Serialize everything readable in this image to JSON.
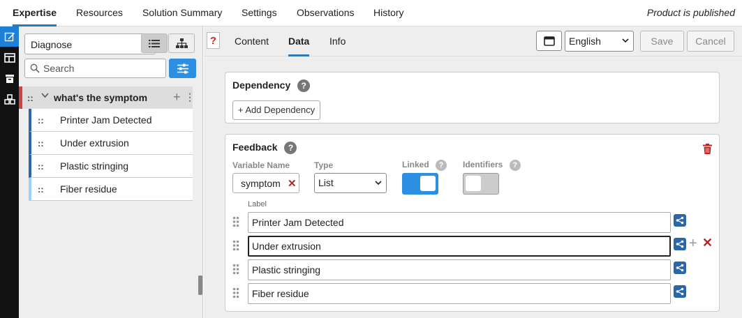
{
  "top_tabs": [
    {
      "label": "Expertise",
      "active": true
    },
    {
      "label": "Resources"
    },
    {
      "label": "Solution Summary"
    },
    {
      "label": "Settings"
    },
    {
      "label": "Observations"
    },
    {
      "label": "History"
    }
  ],
  "status": "Product is published",
  "sidebar": {
    "mode_select": "Diagnose",
    "search_placeholder": "Search",
    "tree_root": "what's the symptom",
    "items": [
      "Printer Jam Detected",
      "Under extrusion",
      "Plastic stringing",
      "Fiber residue"
    ]
  },
  "main": {
    "tabs": [
      {
        "label": "Content"
      },
      {
        "label": "Data",
        "active": true
      },
      {
        "label": "Info"
      }
    ],
    "language": "English",
    "save_label": "Save",
    "cancel_label": "Cancel",
    "dependency": {
      "title": "Dependency",
      "add_label": "+ Add Dependency"
    },
    "feedback": {
      "title": "Feedback",
      "variable_name_label": "Variable Name",
      "variable_name": "symptom",
      "type_label": "Type",
      "type_value": "List",
      "linked_label": "Linked",
      "linked": true,
      "identifiers_label": "Identifiers",
      "identifiers": false,
      "label_header": "Label",
      "labels": [
        "Printer Jam Detected",
        "Under extrusion",
        "Plastic stringing",
        "Fiber residue"
      ]
    }
  },
  "colors": {
    "accent": "#2d8fe0",
    "tab_underline": "#2a7ab8",
    "danger": "#b22222",
    "share": "#2a66a8"
  }
}
